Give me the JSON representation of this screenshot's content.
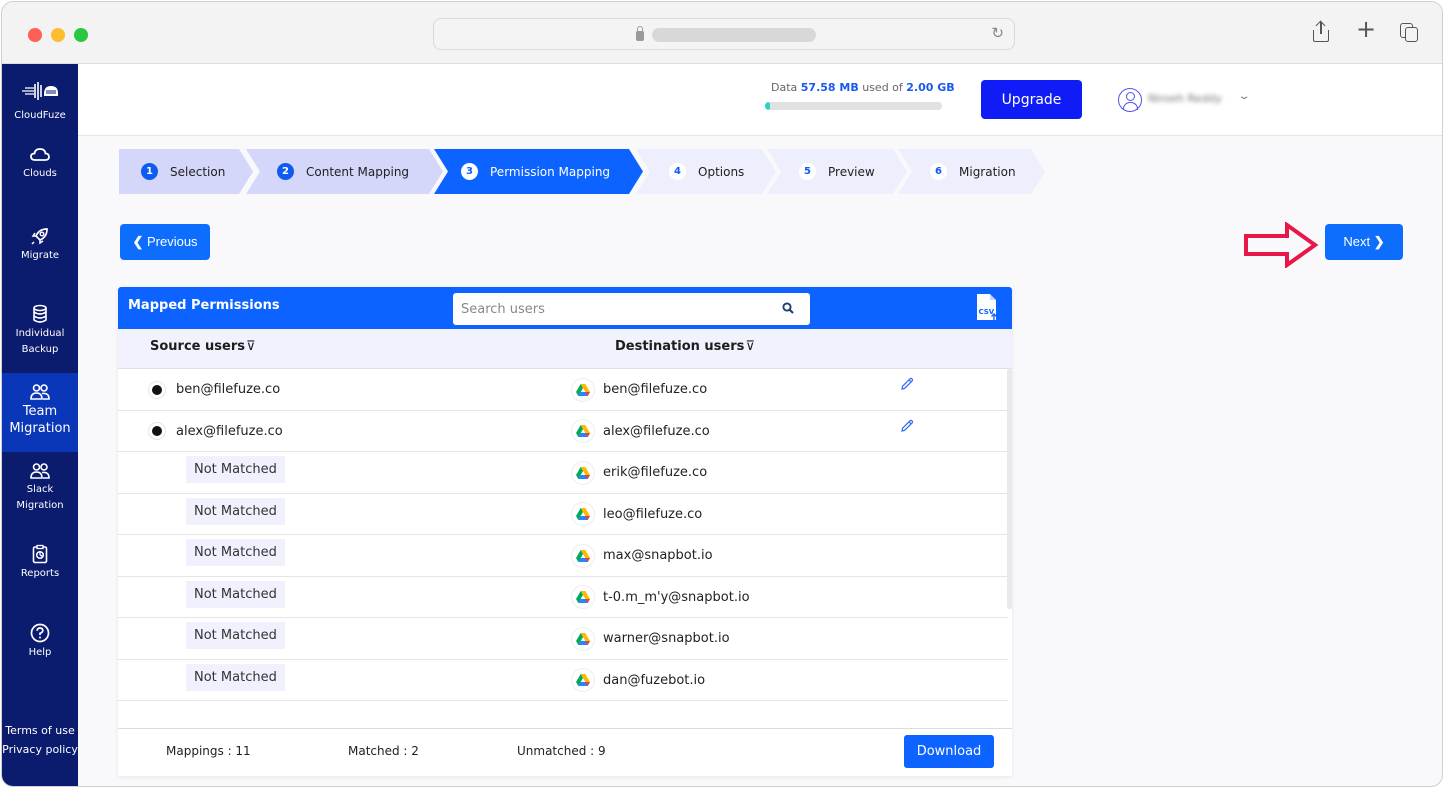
{
  "browser": {
    "url_hidden": true,
    "icons": [
      "lock-icon",
      "reload-icon",
      "share-icon",
      "new-tab-icon",
      "tabs-overview-icon"
    ]
  },
  "sidebar": {
    "brand": "CloudFuze",
    "items": [
      {
        "label": "Clouds",
        "icon": "cloud-icon",
        "active": false
      },
      {
        "label": "Migrate",
        "icon": "rocket-icon",
        "active": false
      },
      {
        "label": "Individual Backup",
        "icon": "database-icon",
        "active": false
      },
      {
        "label": "Team Migration",
        "icon": "users-icon",
        "active": true
      },
      {
        "label": "Slack Migration",
        "icon": "users-icon",
        "active": false
      },
      {
        "label": "Reports",
        "icon": "clipboard-icon",
        "active": false
      },
      {
        "label": "Help",
        "icon": "help-icon",
        "active": false
      }
    ],
    "footer": {
      "terms": "Terms of use",
      "privacy": "Privacy policy"
    }
  },
  "header": {
    "usage_prefix": "Data",
    "usage_used": "57.58 MB",
    "usage_middle": "used of",
    "usage_total": "2.00 GB",
    "usage_fraction": 0.028,
    "upgrade_label": "Upgrade",
    "user_name": "Niroeh Reddy"
  },
  "stepper": {
    "steps": [
      {
        "num": "1",
        "label": "Selection",
        "state": "done"
      },
      {
        "num": "2",
        "label": "Content Mapping",
        "state": "done"
      },
      {
        "num": "3",
        "label": "Permission Mapping",
        "state": "active"
      },
      {
        "num": "4",
        "label": "Options",
        "state": "todo"
      },
      {
        "num": "5",
        "label": "Preview",
        "state": "todo"
      },
      {
        "num": "6",
        "label": "Migration",
        "state": "todo"
      }
    ]
  },
  "nav": {
    "previous_label": "Previous",
    "next_label": "Next"
  },
  "table": {
    "title": "Mapped Permissions",
    "search_placeholder": "Search users",
    "search_value": "",
    "columns": {
      "source": "Source users",
      "destination": "Destination users"
    },
    "rows": [
      {
        "source": "ben@filefuze.co",
        "matched": true,
        "destination": "ben@filefuze.co"
      },
      {
        "source": "alex@filefuze.co",
        "matched": true,
        "destination": "alex@filefuze.co"
      },
      {
        "source": "Not Matched",
        "matched": false,
        "destination": "erik@filefuze.co"
      },
      {
        "source": "Not Matched",
        "matched": false,
        "destination": "leo@filefuze.co"
      },
      {
        "source": "Not Matched",
        "matched": false,
        "destination": "max@snapbot.io"
      },
      {
        "source": "Not Matched",
        "matched": false,
        "destination": "t-0.m_m'y@snapbot.io"
      },
      {
        "source": "Not Matched",
        "matched": false,
        "destination": "warner@snapbot.io"
      },
      {
        "source": "Not Matched",
        "matched": false,
        "destination": "dan@fuzebot.io"
      }
    ],
    "footer": {
      "mappings": "Mappings : 11",
      "matched": "Matched : 2",
      "unmatched": "Unmatched : 9",
      "download_label": "Download"
    }
  },
  "colors": {
    "sidebar_bg": "#0b1b6e",
    "sidebar_active": "#0a36b8",
    "primary": "#0d63ff",
    "upgrade": "#0f1cf5",
    "callout_arrow": "#e8174a",
    "usage_fill": "#26d4c4"
  }
}
